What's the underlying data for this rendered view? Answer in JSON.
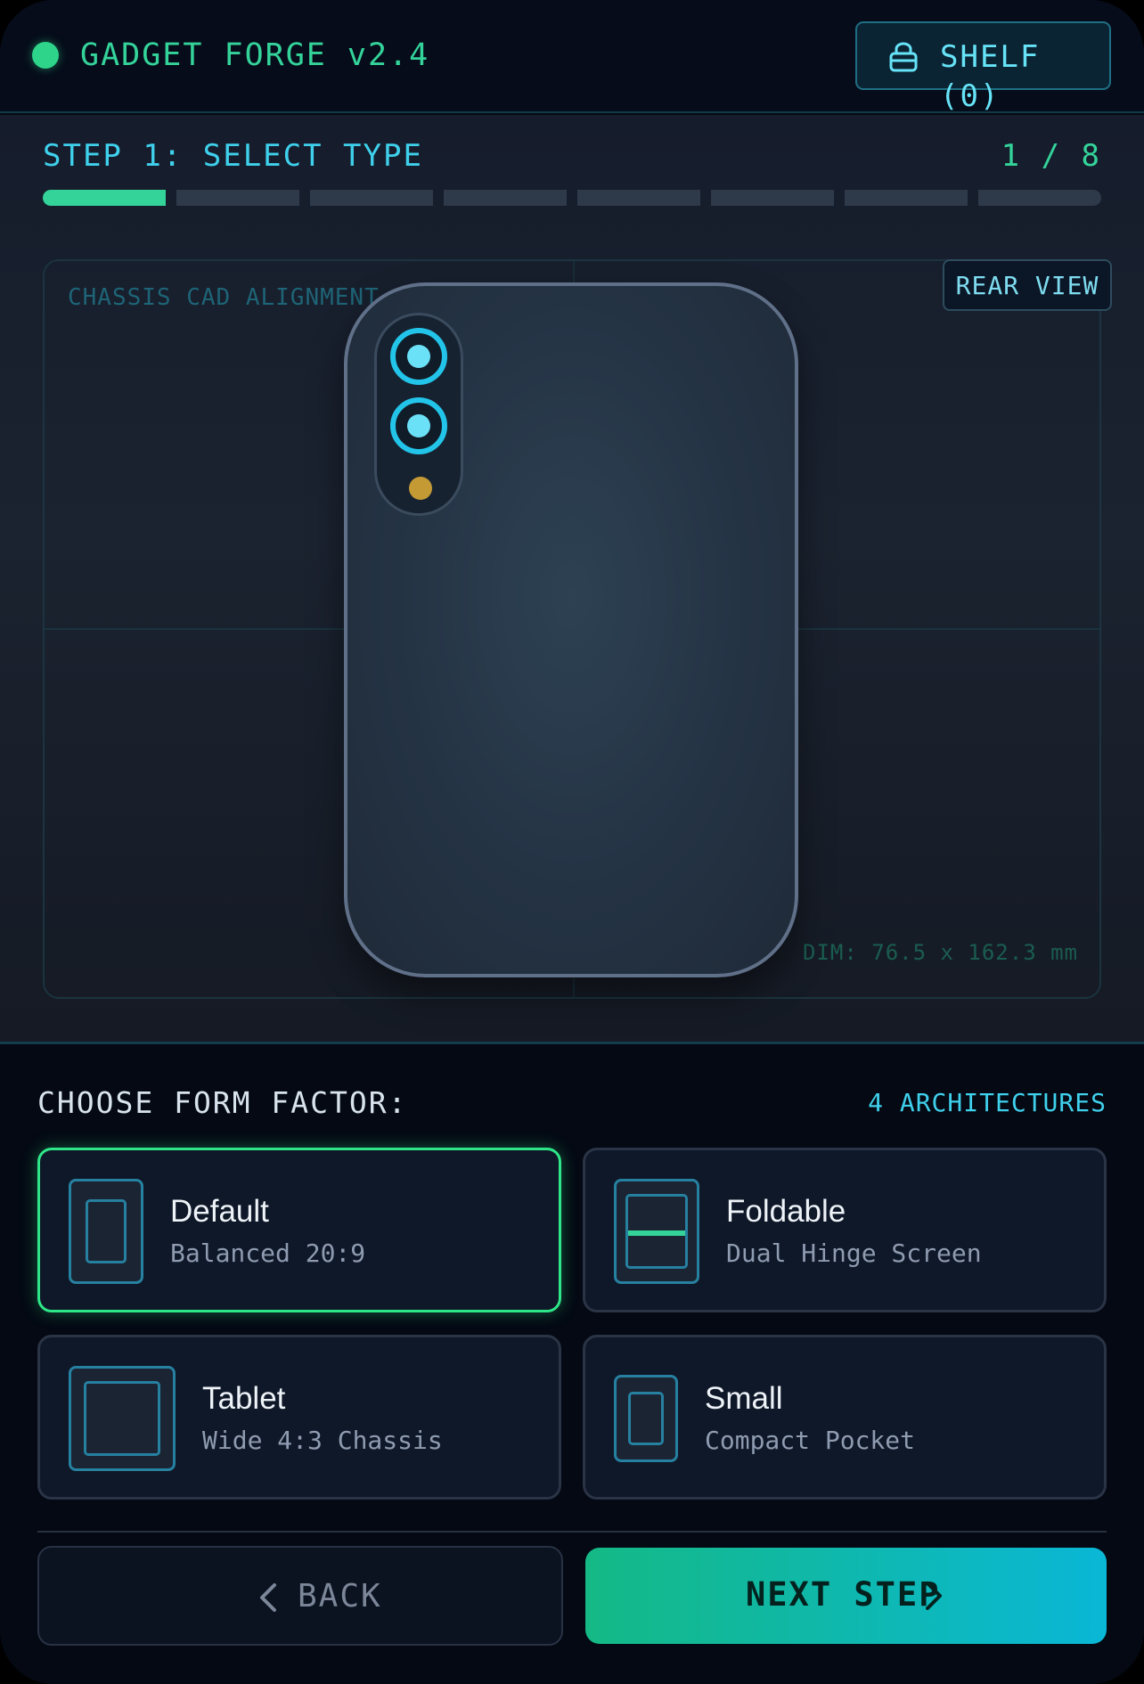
{
  "header": {
    "title": "GADGET FORGE v2.4",
    "shelf_label": "SHELF (0)"
  },
  "step": {
    "title": "STEP 1: SELECT TYPE",
    "counter": "1 / 8",
    "current": 1,
    "total": 8
  },
  "preview": {
    "label": "CHASSIS CAD ALIGNMENT",
    "view_button": "REAR VIEW",
    "dimensions": "DIM: 76.5 x 162.3 mm"
  },
  "form_factor": {
    "heading": "CHOOSE FORM FACTOR:",
    "count_label": "4 ARCHITECTURES",
    "options": [
      {
        "name": "Default",
        "desc": "Balanced 20:9",
        "selected": true
      },
      {
        "name": "Foldable",
        "desc": "Dual Hinge Screen",
        "selected": false
      },
      {
        "name": "Tablet",
        "desc": "Wide 4:3 Chassis",
        "selected": false
      },
      {
        "name": "Small",
        "desc": "Compact Pocket",
        "selected": false
      }
    ]
  },
  "nav": {
    "back_label": "BACK",
    "next_label": "NEXT STEP"
  },
  "colors": {
    "accent_green": "#34d39a",
    "accent_cyan": "#3fd0ec",
    "selected_border": "#2ee688"
  },
  "icons": {
    "status": "status-dot",
    "shelf": "lock-bag-icon",
    "back": "chevron-left-icon",
    "next": "chevron-right-icon"
  }
}
